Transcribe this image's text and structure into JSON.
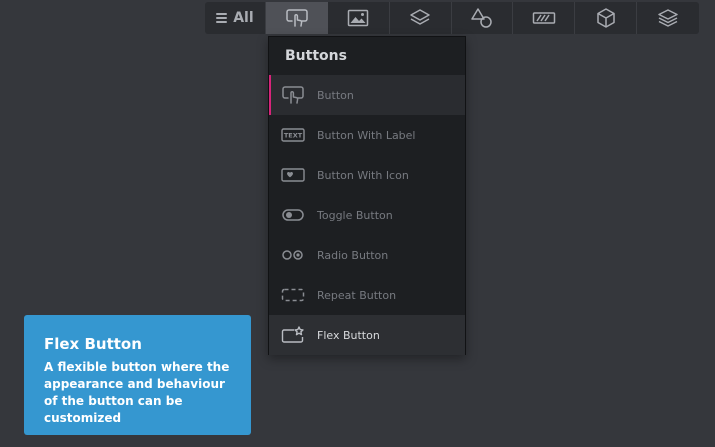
{
  "toolbar": {
    "all_label": "All",
    "items": [
      {
        "icon": "button-touch-icon",
        "active": true
      },
      {
        "icon": "image-icon",
        "active": false
      },
      {
        "icon": "layers-icon",
        "active": false
      },
      {
        "icon": "shapes-icon",
        "active": false
      },
      {
        "icon": "progress-bar-icon",
        "active": false
      },
      {
        "icon": "cube-icon",
        "active": false
      },
      {
        "icon": "stack-icon",
        "active": false
      }
    ]
  },
  "panel": {
    "title": "Buttons",
    "items": [
      {
        "label": "Button",
        "icon": "button-touch-icon"
      },
      {
        "label": "Button With Label",
        "icon": "text-button-icon"
      },
      {
        "label": "Button With Icon",
        "icon": "heart-button-icon"
      },
      {
        "label": "Toggle Button",
        "icon": "toggle-icon"
      },
      {
        "label": "Radio Button",
        "icon": "radio-icon"
      },
      {
        "label": "Repeat Button",
        "icon": "repeat-button-icon"
      },
      {
        "label": "Flex Button",
        "icon": "flex-button-icon"
      }
    ]
  },
  "tooltip": {
    "title": "Flex Button",
    "description": "A flexible button where the appearance and behaviour of the button can be customized"
  },
  "colors": {
    "background": "#35373c",
    "accent": "#d6247a",
    "tooltip": "#3597d0"
  }
}
